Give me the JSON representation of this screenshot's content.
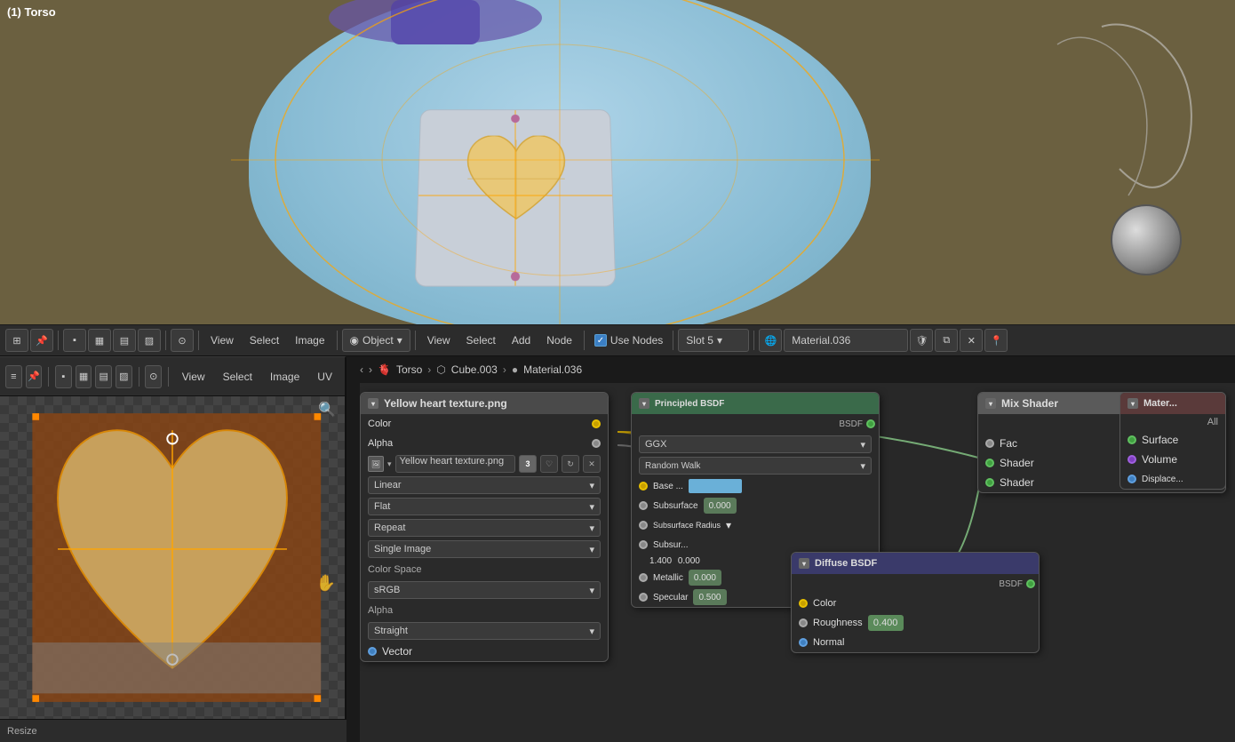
{
  "viewport": {
    "label": "(1) Torso"
  },
  "toolbar": {
    "view_label": "View",
    "select_label": "Select",
    "image_label": "Image",
    "object_label": "Object",
    "view2_label": "View",
    "select2_label": "Select",
    "add_label": "Add",
    "node_label": "Node",
    "use_nodes_label": "Use Nodes",
    "slot_label": "Slot 5",
    "material_name": "Material.036"
  },
  "breadcrumb": {
    "torso": "Torso",
    "cube": "Cube.003",
    "material": "Material.036",
    "sep1": "›",
    "sep2": "›"
  },
  "texture_node": {
    "title": "Yellow heart texture.png",
    "color_label": "Color",
    "alpha_label": "Alpha",
    "image_name": "Yellow heart texture.png",
    "num": "3",
    "interpolation_label": "Linear",
    "projection_label": "Flat",
    "extension_label": "Repeat",
    "source_label": "Single Image",
    "color_space_label": "Color Space",
    "color_space_value": "sRGB",
    "alpha_label2": "Alpha",
    "alpha_value": "Straight",
    "vector_label": "Vector"
  },
  "principled_node": {
    "title": "Principled BSDF",
    "bsdf_label": "BSDF",
    "distribution": "GGX",
    "subsurface_method": "Random Walk",
    "base_color_label": "Base ...",
    "subsurface_label": "Subsurface",
    "subsurface_value": "0.000",
    "subsurface_radius_label": "Subsurface Radius",
    "subsur_label": "Subsur...",
    "subsurface_val2": "1.400",
    "subsurface_val3": "0.000",
    "metallic_label": "Metallic",
    "metallic_value": "0.000",
    "specular_label": "Specular",
    "specular_value": "0.500"
  },
  "diffuse_node": {
    "title": "Diffuse BSDF",
    "bsdf_label": "BSDF",
    "color_label": "Color",
    "roughness_label": "Roughness",
    "roughness_value": "0.400",
    "normal_label": "Normal"
  },
  "mix_shader_node": {
    "title": "Mix Shader",
    "shader_label": "Shader",
    "fac_label": "Fac",
    "shader1_label": "Shader",
    "shader2_label": "Shader"
  },
  "material_output_node": {
    "title": "Mater...",
    "all_label": "All",
    "surface_label": "Surface",
    "volume_label": "Volume",
    "displacement_label": "Displace..."
  },
  "status_bar": {
    "resize_label": "Resize"
  }
}
